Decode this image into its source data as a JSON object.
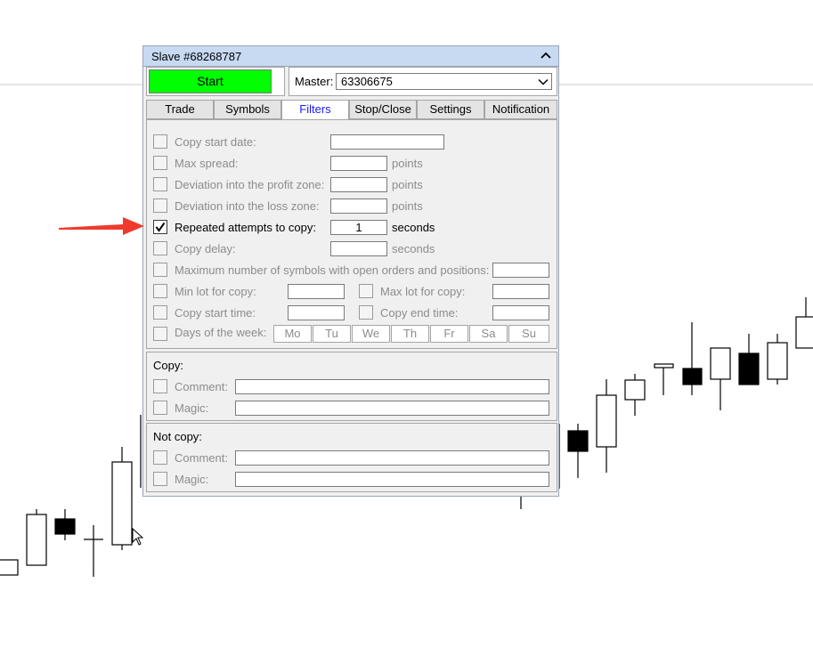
{
  "window": {
    "title": "Slave #68268787"
  },
  "header": {
    "start_label": "Start",
    "master_label": "Master:",
    "master_value": "63306675"
  },
  "tabs": [
    {
      "label": "Trade",
      "active": false
    },
    {
      "label": "Symbols",
      "active": false
    },
    {
      "label": "Filters",
      "active": true
    },
    {
      "label": "Stop/Close",
      "active": false
    },
    {
      "label": "Settings",
      "active": false
    },
    {
      "label": "Notification",
      "active": false
    }
  ],
  "filters": {
    "copy_start_date": {
      "label": "Copy start date:",
      "value": "",
      "checked": false
    },
    "max_spread": {
      "label": "Max spread:",
      "value": "",
      "unit": "points",
      "checked": false
    },
    "deviation_profit": {
      "label": "Deviation into the profit zone:",
      "value": "",
      "unit": "points",
      "checked": false
    },
    "deviation_loss": {
      "label": "Deviation into the loss zone:",
      "value": "",
      "unit": "points",
      "checked": false
    },
    "repeated_attempts": {
      "label": "Repeated attempts to copy:",
      "value": "1",
      "unit": "seconds",
      "checked": true
    },
    "copy_delay": {
      "label": "Copy delay:",
      "value": "",
      "unit": "seconds",
      "checked": false
    },
    "max_symbols": {
      "label": "Maximum number of symbols with open orders and positions:",
      "value": "",
      "checked": false
    },
    "min_lot": {
      "label": "Min lot for copy:",
      "value": "",
      "checked": false
    },
    "max_lot": {
      "label": "Max lot for copy:",
      "value": "",
      "checked": false
    },
    "copy_start_time": {
      "label": "Copy start time:",
      "value": "",
      "checked": false
    },
    "copy_end_time": {
      "label": "Copy end time:",
      "value": "",
      "checked": false
    },
    "days_of_week": {
      "label": "Days of the week:",
      "checked": false,
      "days": [
        "Mo",
        "Tu",
        "We",
        "Th",
        "Fr",
        "Sa",
        "Su"
      ]
    }
  },
  "copy_section": {
    "title": "Copy:",
    "comment_label": "Comment:",
    "comment_value": "",
    "magic_label": "Magic:",
    "magic_value": ""
  },
  "not_copy_section": {
    "title": "Not copy:",
    "comment_label": "Comment:",
    "comment_value": "",
    "magic_label": "Magic:",
    "magic_value": ""
  },
  "icons": {
    "collapse": "chevron-up-icon",
    "dropdown": "chevron-down-icon",
    "check": "checkmark-icon",
    "annotation": "red-arrow-icon",
    "pointer": "mouse-cursor-icon"
  },
  "colors": {
    "start_button": "#00ff00",
    "titlebar": "#c7daf2",
    "active_tab_text": "#1a1aff",
    "annotation_arrow": "#f03a2e",
    "candle_bear": "#000000",
    "candle_bull": "#ffffff"
  }
}
